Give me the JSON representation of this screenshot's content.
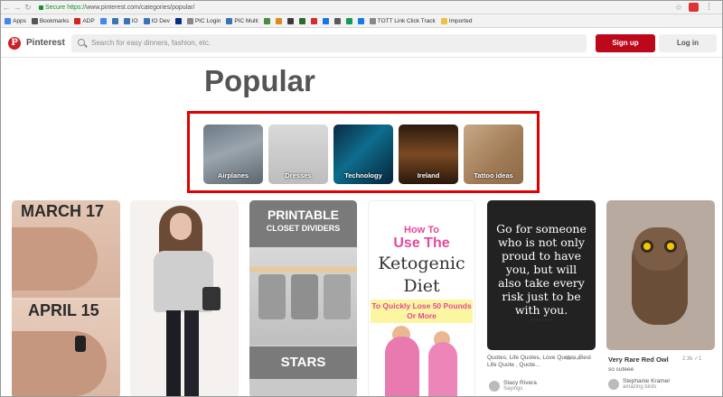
{
  "browser": {
    "secure_label": "Secure",
    "url_scheme": "https://",
    "url_rest": "www.pinterest.com/categories/popular/"
  },
  "bookmarks": [
    {
      "label": "Apps",
      "icon": "apps-icon",
      "color": "#4285f4"
    },
    {
      "label": "Bookmarks",
      "icon": "star-icon",
      "color": "#555555"
    },
    {
      "label": "ADP",
      "icon": "adp-icon",
      "color": "#d0271d"
    },
    {
      "label": "",
      "icon": "google-icon",
      "color": "#4285f4"
    },
    {
      "label": "",
      "icon": "globe-icon",
      "color": "#3b73b9"
    },
    {
      "label": "IO",
      "icon": "globe-icon",
      "color": "#3b73b9"
    },
    {
      "label": "IO Dev",
      "icon": "globe-icon",
      "color": "#3b73b9"
    },
    {
      "label": "",
      "icon": "paypal-icon",
      "color": "#003087"
    },
    {
      "label": "PIC Login",
      "icon": "doc-icon",
      "color": "#888888"
    },
    {
      "label": "PIC Multi",
      "icon": "globe-icon",
      "color": "#3b73b9"
    },
    {
      "label": "",
      "icon": "ext-icon",
      "color": "#4a8c3f"
    },
    {
      "label": "",
      "icon": "ext-icon",
      "color": "#e08a1e"
    },
    {
      "label": "",
      "icon": "ext-icon",
      "color": "#3a3a3a"
    },
    {
      "label": "",
      "icon": "ext-icon",
      "color": "#2d6a2d"
    },
    {
      "label": "",
      "icon": "ext-icon",
      "color": "#d42b2b"
    },
    {
      "label": "",
      "icon": "ext-icon",
      "color": "#1a73e8"
    },
    {
      "label": "",
      "icon": "ext-icon",
      "color": "#5a5a5a"
    },
    {
      "label": "",
      "icon": "ext-icon",
      "color": "#0f9d58"
    },
    {
      "label": "",
      "icon": "ext-icon",
      "color": "#1877f2"
    },
    {
      "label": "TOTT Link Click Track",
      "icon": "doc-icon",
      "color": "#888888"
    },
    {
      "label": "Imported",
      "icon": "folder-icon",
      "color": "#f0c040"
    }
  ],
  "header": {
    "brand": "Pinterest",
    "search_placeholder": "Search for easy dinners, fashion, etc.",
    "signup_label": "Sign up",
    "login_label": "Log in",
    "accent_color": "#bd081c"
  },
  "page": {
    "title": "Popular"
  },
  "categories": [
    {
      "label": "Airplanes"
    },
    {
      "label": "Dresses"
    },
    {
      "label": "Technology"
    },
    {
      "label": "Ireland"
    },
    {
      "label": "Tattoo ideas"
    }
  ],
  "pins": {
    "p1": {
      "line1": "MARCH 17",
      "line2": "APRIL 15"
    },
    "p3": {
      "line1": "PRINTABLE",
      "line2": "CLOSET DIVIDERS",
      "line3": "STARS"
    },
    "p4": {
      "line1": "How To",
      "line2": "Use The",
      "line3": "Ketogenic",
      "line4": "Diet",
      "line5": "To Quickly Lose 50 Pounds Or More"
    },
    "p5": {
      "quote": "Go for someone who is not only proud to have you, but will also take every risk just to be with you.",
      "caption": "Quotes, Life Quotes, Love Quotes, Best Life Quote , Quote...",
      "stats": "4k ✓4",
      "user": "Stacy Rivera",
      "board": "Sayings"
    },
    "p6": {
      "title": "Very Rare Red Owl",
      "stats": "2.3k ✓1",
      "subtitle": "so cuteee",
      "user": "Stephanie Kramer",
      "board": "amazing birds"
    }
  }
}
